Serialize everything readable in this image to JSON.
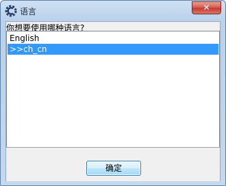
{
  "window": {
    "title": "语言"
  },
  "dialog": {
    "prompt": "你想要使用哪种语言?",
    "languages": [
      "English",
      ">>ch_cn"
    ],
    "selected_index": 1,
    "ok_label": "确定"
  },
  "icons": {
    "app": "gear-c-icon",
    "close": "close-icon"
  },
  "colors": {
    "selection": "#3399ff",
    "close_button": "#c7463b",
    "title_bar": "#b9d1ea"
  }
}
